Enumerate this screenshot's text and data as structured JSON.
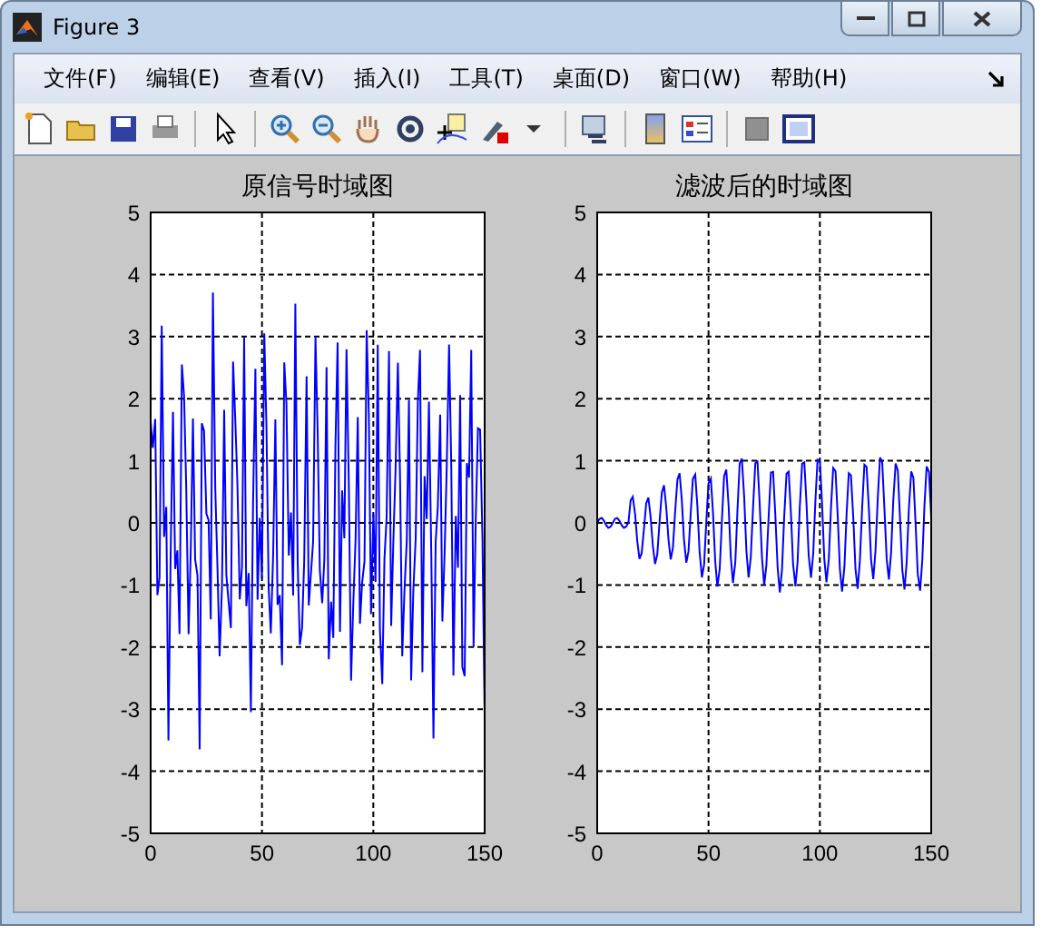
{
  "window": {
    "title": "Figure 3"
  },
  "menu": [
    {
      "label": "文件(F)"
    },
    {
      "label": "编辑(E)"
    },
    {
      "label": "查看(V)"
    },
    {
      "label": "插入(I)"
    },
    {
      "label": "工具(T)"
    },
    {
      "label": "桌面(D)"
    },
    {
      "label": "窗口(W)"
    },
    {
      "label": "帮助(H)"
    }
  ],
  "plots": [
    {
      "title": "原信号时域图",
      "kind": "noisy",
      "xticks": [
        "0",
        "50",
        "100",
        "150"
      ],
      "yticks": [
        "5",
        "4",
        "3",
        "2",
        "1",
        "0",
        "-1",
        "-2",
        "-3",
        "-4",
        "-5"
      ]
    },
    {
      "title": "滤波后的时域图",
      "kind": "filtered",
      "xticks": [
        "0",
        "50",
        "100",
        "150"
      ],
      "yticks": [
        "5",
        "4",
        "3",
        "2",
        "1",
        "0",
        "-1",
        "-2",
        "-3",
        "-4",
        "-5"
      ]
    }
  ]
}
